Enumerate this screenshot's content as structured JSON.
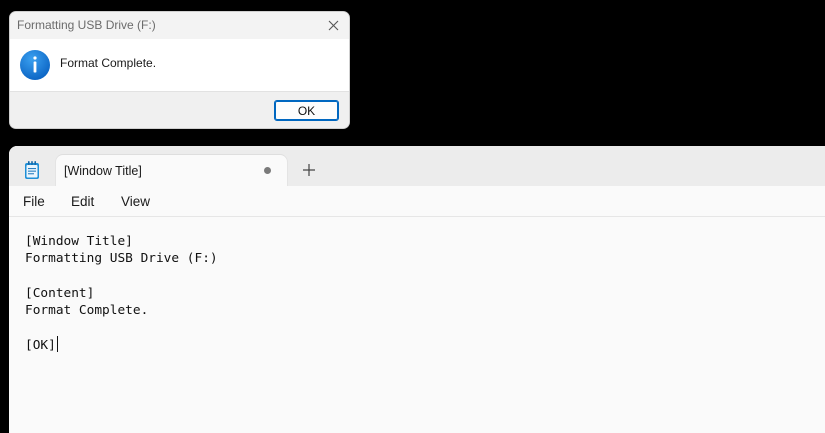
{
  "dialog": {
    "title": "Formatting USB Drive (F:)",
    "message": "Format Complete.",
    "ok_label": "OK",
    "icon": "info-icon",
    "accent_color": "#0067c0"
  },
  "notepad": {
    "icon": "notepad-icon",
    "tab": {
      "label": "[Window Title]",
      "unsaved_indicator": "unsaved-dot"
    },
    "new_tab_icon": "plus-icon",
    "menu": {
      "file": "File",
      "edit": "Edit",
      "view": "View"
    },
    "content_lines": [
      "[Window Title]",
      "Formatting USB Drive (F:)",
      "",
      "[Content]",
      "Format Complete.",
      "",
      "[OK]"
    ]
  }
}
